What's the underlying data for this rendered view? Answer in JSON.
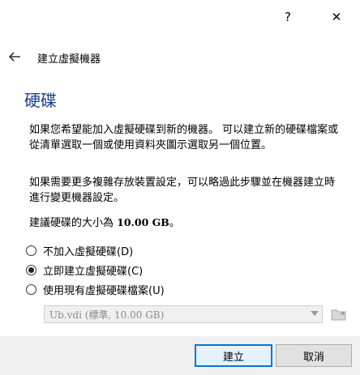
{
  "titlebar": {
    "help_label": "?",
    "close_label": "✕"
  },
  "header": {
    "back_icon": "arrow-left-icon",
    "title": "建立虛擬機器"
  },
  "section": {
    "title": "硬碟"
  },
  "paragraphs": {
    "p1": "如果您希望能加入虛擬硬碟到新的機器。 可以建立新的硬碟檔案或從清單選取一個或使用資料夾圖示選取另一個位置。",
    "p2": "如果需要更多複雜存放裝置設定，可以略過此步驟並在機器建立時進行變更機器設定。",
    "p3_prefix": "建議硬碟的大小為 ",
    "p3_size": "10.00 GB",
    "p3_suffix": "。"
  },
  "options": [
    {
      "label": "不加入虛擬硬碟(D)",
      "checked": false
    },
    {
      "label": "立即建立虛擬硬碟(C)",
      "checked": true
    },
    {
      "label": "使用現有虛擬硬碟檔案(U)",
      "checked": false
    }
  ],
  "disk_select": {
    "value": "Ub.vdi (標準, 10.00 GB)",
    "enabled": false
  },
  "buttons": {
    "create": "建立",
    "cancel": "取消"
  },
  "colors": {
    "section_title": "#1a3d8c",
    "primary_border": "#0078d7"
  }
}
